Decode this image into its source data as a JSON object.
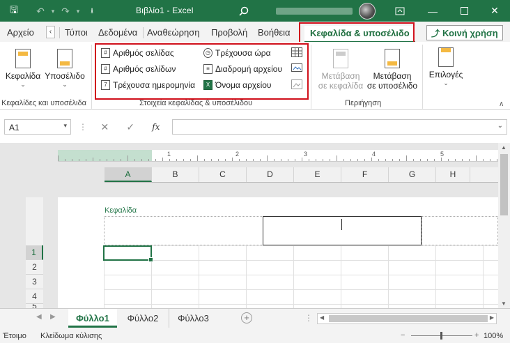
{
  "window": {
    "title": "Βιβλίο1 - Excel"
  },
  "tabs": {
    "items": [
      "Αρχείο",
      "Τύποι",
      "Δεδομένα",
      "Αναθεώρηση",
      "Προβολή",
      "Βοήθεια"
    ],
    "active": "Κεφαλίδα & υποσέλιδο",
    "share": "Κοινή χρήση"
  },
  "ribbon": {
    "hf_group": {
      "header_label": "Κεφαλίδα",
      "footer_label": "Υποσέλιδο",
      "caption": "Κεφαλίδες και υποσέλιδα"
    },
    "elements_group": {
      "page_number": "Αριθμός σελίδας",
      "page_count": "Αριθμός σελίδων",
      "current_date": "Τρέχουσα ημερομηνία",
      "current_time": "Τρέχουσα ώρα",
      "file_path": "Διαδρομή αρχείου",
      "file_name": "Όνομα αρχείου",
      "caption": "Στοιχεία κεφαλίδας & υποσέλιδου"
    },
    "nav_group": {
      "goto_header_1": "Μετάβαση",
      "goto_header_2": "σε κεφαλίδα",
      "goto_footer_1": "Μετάβαση",
      "goto_footer_2": "σε υποσέλιδο",
      "caption": "Περιήγηση"
    },
    "options": {
      "label": "Επιλογές"
    }
  },
  "formula_bar": {
    "name_box": "A1",
    "fx": "fx"
  },
  "ruler": {
    "labels": [
      "1",
      "2",
      "3",
      "4",
      "5"
    ]
  },
  "columns": [
    "A",
    "B",
    "C",
    "D",
    "E",
    "F",
    "G",
    "H"
  ],
  "rows": [
    "1",
    "2",
    "3",
    "4",
    "5"
  ],
  "page": {
    "header_label": "Κεφαλίδα"
  },
  "sheets": {
    "items": [
      "Φύλλο1",
      "Φύλλο2",
      "Φύλλο3"
    ],
    "active_index": 0
  },
  "status": {
    "ready": "Έτοιμο",
    "scroll_lock": "Κλείδωμα κύλισης",
    "zoom": "100%"
  },
  "colors": {
    "accent": "#217346",
    "highlight": "#d0101b"
  }
}
